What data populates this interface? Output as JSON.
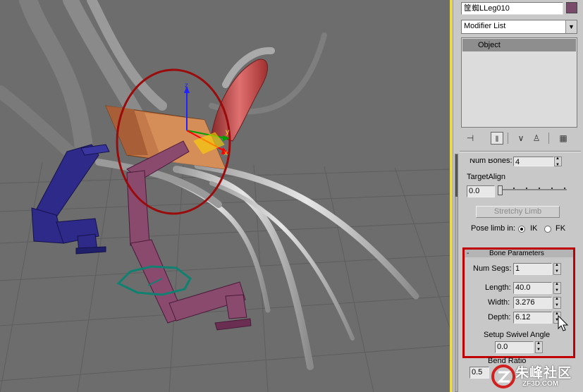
{
  "object_name": "筐蜘LLeg010",
  "object_color": "#7a4a6a",
  "modifier_list": {
    "label": "Modifier List"
  },
  "stack": {
    "items": [
      "Object"
    ]
  },
  "toolbar_icons": [
    "pin-stack-icon",
    "show-end-result-icon",
    "make-unique-icon",
    "remove-modifier-icon",
    "configure-sets-icon"
  ],
  "ik_params": {
    "num_bones_label": "Num Bones:",
    "num_bones_value": "4",
    "target_align_label": "TargetAlign",
    "target_align_value": "0.0",
    "stretchy_limb_label": "Stretchy Limb",
    "pose_limb_label": "Pose limb in:",
    "ik_label": "IK",
    "fk_label": "FK",
    "pose_mode": "IK"
  },
  "bone_params": {
    "title": "Bone Parameters",
    "collapse_symbol": "-",
    "num_segs_label": "Num Segs:",
    "num_segs_value": "1",
    "length_label": "Length:",
    "length_value": "40.0",
    "width_label": "Width:",
    "width_value": "3.276",
    "depth_label": "Depth:",
    "depth_value": "6.12",
    "swivel_label": "Setup Swivel Angle",
    "swivel_value": "0.0",
    "bend_ratio_label": "Bend Ratio",
    "bend_ratio_value": "0.5"
  },
  "gizmo": {
    "z_label": "z",
    "y_label": "y",
    "x_label": "x"
  },
  "watermark": {
    "text": "朱峰社区",
    "url": "ZF3D.COM"
  },
  "colors": {
    "highlight": "#c00000",
    "viewport_border": "#e8d84a",
    "bone_blue": "#2e2a8a",
    "bone_purple": "#8a4a6e",
    "bone_orange": "#c47a4a",
    "ik_circle": "#9a0c0c",
    "ground_circle": "#108070"
  }
}
